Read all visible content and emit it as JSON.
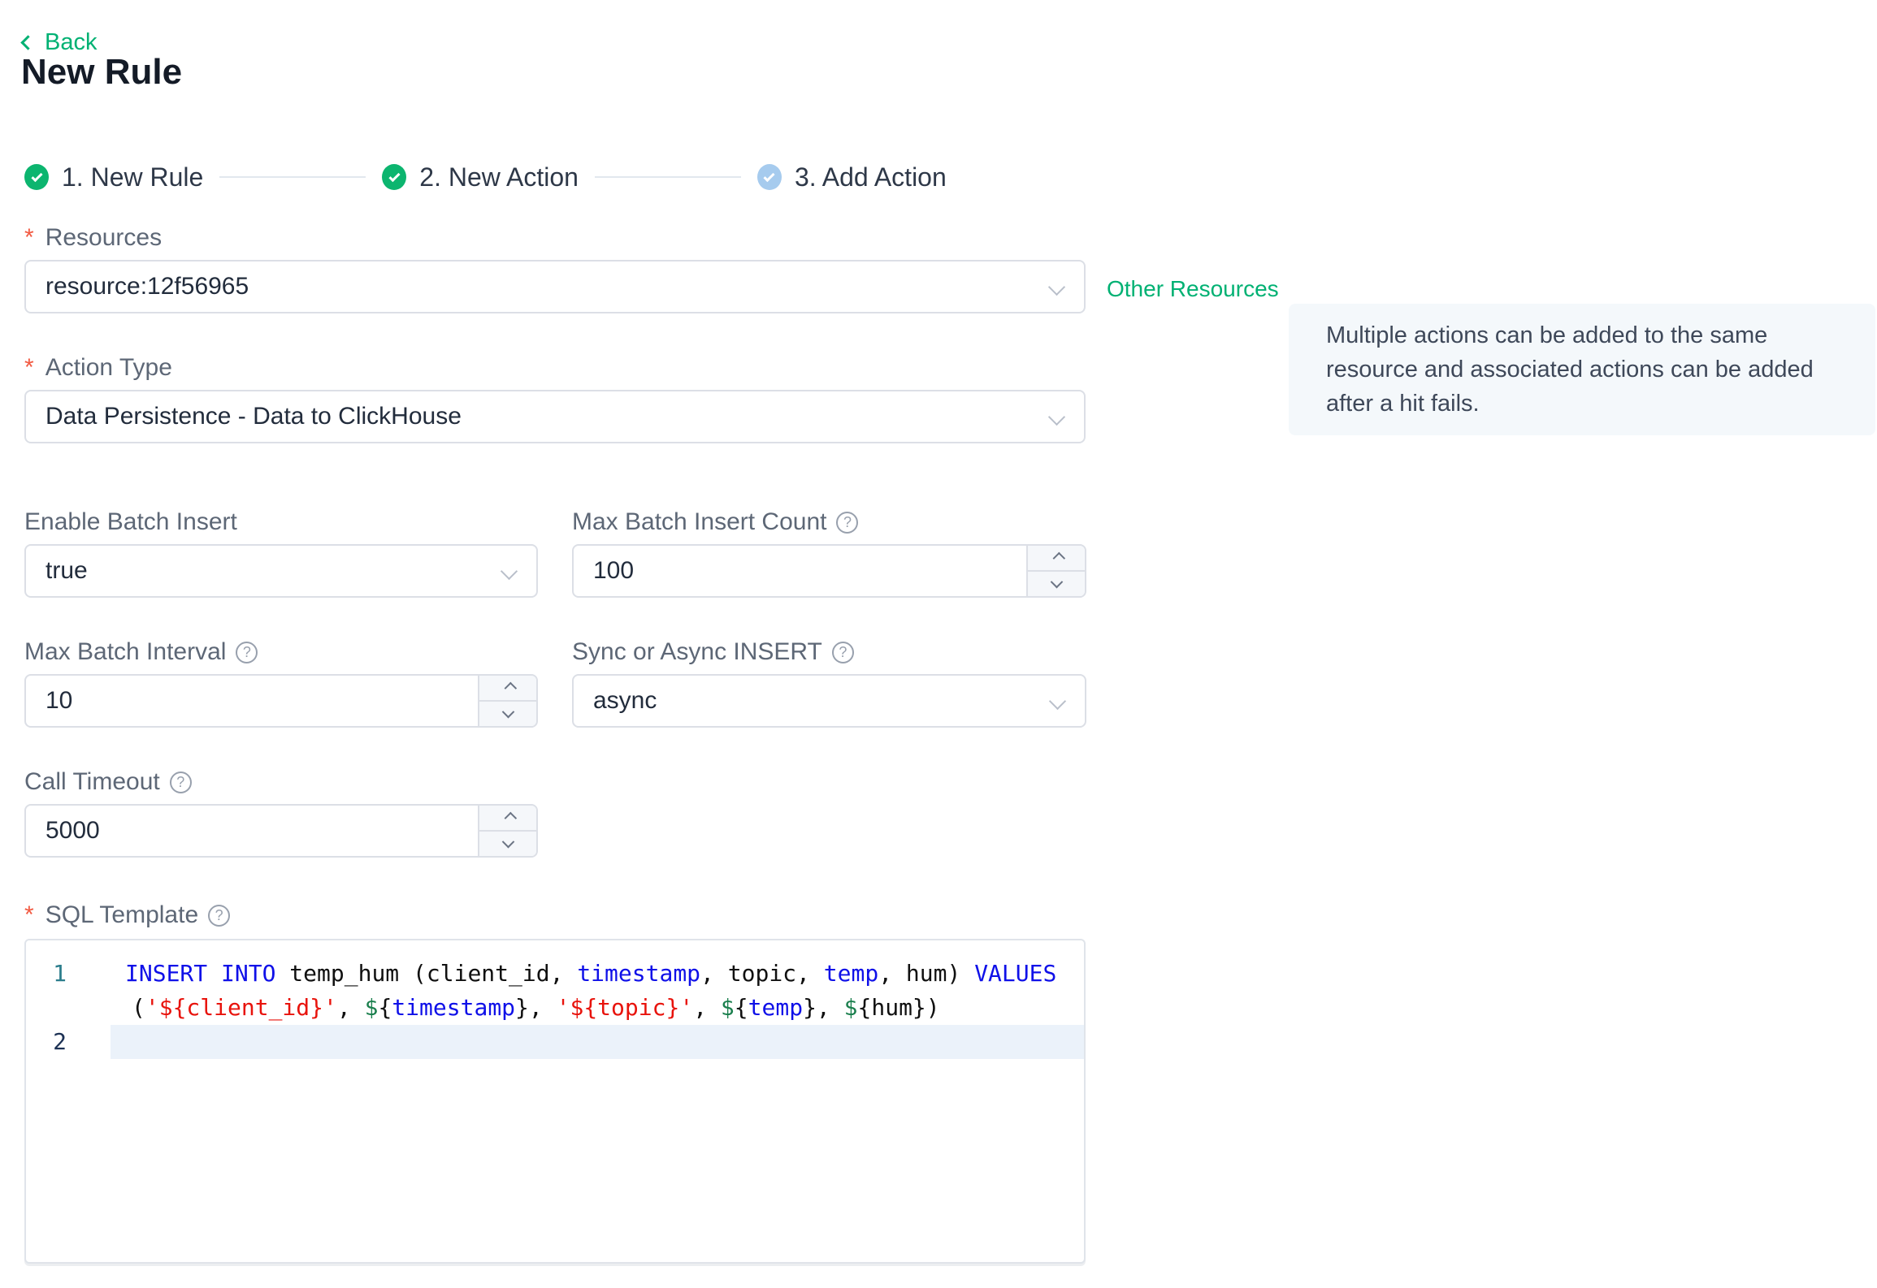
{
  "page": {
    "back_label": "Back",
    "title": "New Rule",
    "required_marker": "*"
  },
  "icons": {
    "help_glyph": "?"
  },
  "steps": [
    {
      "label": "1. New Rule",
      "state": "done"
    },
    {
      "label": "2. New Action",
      "state": "done"
    },
    {
      "label": "3. Add Action",
      "state": "pending"
    }
  ],
  "form": {
    "resources": {
      "label": "Resources",
      "required": true,
      "value": "resource:12f56965"
    },
    "other_resources_label": "Other Resources",
    "action_type": {
      "label": "Action Type",
      "required": true,
      "value": "Data Persistence - Data to ClickHouse"
    },
    "enable_batch_insert": {
      "label": "Enable Batch Insert",
      "value": "true"
    },
    "max_batch_insert_count": {
      "label": "Max Batch Insert Count",
      "value": "100",
      "has_help": true
    },
    "max_batch_interval": {
      "label": "Max Batch Interval",
      "value": "10",
      "has_help": true
    },
    "sync_or_async_insert": {
      "label": "Sync or Async INSERT",
      "value": "async",
      "has_help": true
    },
    "call_timeout": {
      "label": "Call Timeout",
      "value": "5000",
      "has_help": true
    },
    "sql_template": {
      "label": "SQL Template",
      "required": true,
      "has_help": true
    }
  },
  "info_box": {
    "text": "Multiple actions can be added to the same resource and associated actions can be added after a hit fails."
  },
  "sql_editor": {
    "rows": [
      {
        "line_number": "1",
        "number_class": "ln-teal",
        "highlight": false,
        "wrapped": false,
        "tokens": [
          [
            "kw",
            "INSERT INTO"
          ],
          [
            "pl",
            " temp_hum (client_id, "
          ],
          [
            "kw",
            "timestamp"
          ],
          [
            "pl",
            ", topic, "
          ],
          [
            "kw",
            "temp"
          ],
          [
            "pl",
            ", hum) "
          ],
          [
            "kw",
            "VALUES"
          ]
        ]
      },
      {
        "line_number": "",
        "number_class": "",
        "highlight": false,
        "wrapped": true,
        "tokens": [
          [
            "pl",
            "("
          ],
          [
            "str",
            "'${client_id}'"
          ],
          [
            "pl",
            ", "
          ],
          [
            "var",
            "$"
          ],
          [
            "pl",
            "{"
          ],
          [
            "kw",
            "timestamp"
          ],
          [
            "pl",
            "}, "
          ],
          [
            "str",
            "'${topic}'"
          ],
          [
            "pl",
            ", "
          ],
          [
            "var",
            "$"
          ],
          [
            "pl",
            "{"
          ],
          [
            "kw",
            "temp"
          ],
          [
            "pl",
            "}, "
          ],
          [
            "var",
            "$"
          ],
          [
            "pl",
            "{hum})"
          ]
        ]
      },
      {
        "line_number": "2",
        "number_class": "ln-navy",
        "highlight": true,
        "wrapped": false,
        "tokens": []
      }
    ]
  },
  "colors": {
    "accent_green": "#00b173",
    "step_done_green": "#0cb56f",
    "step_pending_blue": "#a6cbee",
    "required_red": "#f25a42",
    "active_line_bg": "#ebf2fa",
    "info_box_bg": "#f4f8fb",
    "code_keyword_blue": "#0f10e8",
    "code_string_red": "#e8130c",
    "code_variable_green": "#1a7f4d",
    "line_number_1": "#2b7d8c",
    "line_number_2": "#1c3154",
    "border_gray": "#dcdfe6"
  }
}
